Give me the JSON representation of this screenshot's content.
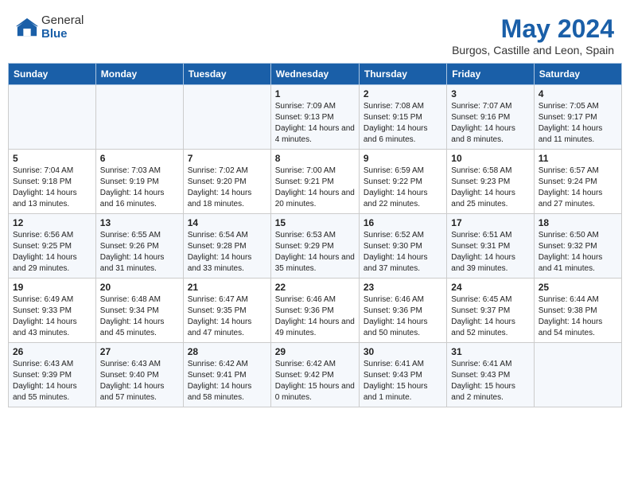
{
  "app": {
    "logo_general": "General",
    "logo_blue": "Blue"
  },
  "header": {
    "title": "May 2024",
    "subtitle": "Burgos, Castille and Leon, Spain"
  },
  "weekdays": [
    "Sunday",
    "Monday",
    "Tuesday",
    "Wednesday",
    "Thursday",
    "Friday",
    "Saturday"
  ],
  "weeks": [
    [
      {
        "day": "",
        "sunrise": "",
        "sunset": "",
        "daylight": ""
      },
      {
        "day": "",
        "sunrise": "",
        "sunset": "",
        "daylight": ""
      },
      {
        "day": "",
        "sunrise": "",
        "sunset": "",
        "daylight": ""
      },
      {
        "day": "1",
        "sunrise": "Sunrise: 7:09 AM",
        "sunset": "Sunset: 9:13 PM",
        "daylight": "Daylight: 14 hours and 4 minutes."
      },
      {
        "day": "2",
        "sunrise": "Sunrise: 7:08 AM",
        "sunset": "Sunset: 9:15 PM",
        "daylight": "Daylight: 14 hours and 6 minutes."
      },
      {
        "day": "3",
        "sunrise": "Sunrise: 7:07 AM",
        "sunset": "Sunset: 9:16 PM",
        "daylight": "Daylight: 14 hours and 8 minutes."
      },
      {
        "day": "4",
        "sunrise": "Sunrise: 7:05 AM",
        "sunset": "Sunset: 9:17 PM",
        "daylight": "Daylight: 14 hours and 11 minutes."
      }
    ],
    [
      {
        "day": "5",
        "sunrise": "Sunrise: 7:04 AM",
        "sunset": "Sunset: 9:18 PM",
        "daylight": "Daylight: 14 hours and 13 minutes."
      },
      {
        "day": "6",
        "sunrise": "Sunrise: 7:03 AM",
        "sunset": "Sunset: 9:19 PM",
        "daylight": "Daylight: 14 hours and 16 minutes."
      },
      {
        "day": "7",
        "sunrise": "Sunrise: 7:02 AM",
        "sunset": "Sunset: 9:20 PM",
        "daylight": "Daylight: 14 hours and 18 minutes."
      },
      {
        "day": "8",
        "sunrise": "Sunrise: 7:00 AM",
        "sunset": "Sunset: 9:21 PM",
        "daylight": "Daylight: 14 hours and 20 minutes."
      },
      {
        "day": "9",
        "sunrise": "Sunrise: 6:59 AM",
        "sunset": "Sunset: 9:22 PM",
        "daylight": "Daylight: 14 hours and 22 minutes."
      },
      {
        "day": "10",
        "sunrise": "Sunrise: 6:58 AM",
        "sunset": "Sunset: 9:23 PM",
        "daylight": "Daylight: 14 hours and 25 minutes."
      },
      {
        "day": "11",
        "sunrise": "Sunrise: 6:57 AM",
        "sunset": "Sunset: 9:24 PM",
        "daylight": "Daylight: 14 hours and 27 minutes."
      }
    ],
    [
      {
        "day": "12",
        "sunrise": "Sunrise: 6:56 AM",
        "sunset": "Sunset: 9:25 PM",
        "daylight": "Daylight: 14 hours and 29 minutes."
      },
      {
        "day": "13",
        "sunrise": "Sunrise: 6:55 AM",
        "sunset": "Sunset: 9:26 PM",
        "daylight": "Daylight: 14 hours and 31 minutes."
      },
      {
        "day": "14",
        "sunrise": "Sunrise: 6:54 AM",
        "sunset": "Sunset: 9:28 PM",
        "daylight": "Daylight: 14 hours and 33 minutes."
      },
      {
        "day": "15",
        "sunrise": "Sunrise: 6:53 AM",
        "sunset": "Sunset: 9:29 PM",
        "daylight": "Daylight: 14 hours and 35 minutes."
      },
      {
        "day": "16",
        "sunrise": "Sunrise: 6:52 AM",
        "sunset": "Sunset: 9:30 PM",
        "daylight": "Daylight: 14 hours and 37 minutes."
      },
      {
        "day": "17",
        "sunrise": "Sunrise: 6:51 AM",
        "sunset": "Sunset: 9:31 PM",
        "daylight": "Daylight: 14 hours and 39 minutes."
      },
      {
        "day": "18",
        "sunrise": "Sunrise: 6:50 AM",
        "sunset": "Sunset: 9:32 PM",
        "daylight": "Daylight: 14 hours and 41 minutes."
      }
    ],
    [
      {
        "day": "19",
        "sunrise": "Sunrise: 6:49 AM",
        "sunset": "Sunset: 9:33 PM",
        "daylight": "Daylight: 14 hours and 43 minutes."
      },
      {
        "day": "20",
        "sunrise": "Sunrise: 6:48 AM",
        "sunset": "Sunset: 9:34 PM",
        "daylight": "Daylight: 14 hours and 45 minutes."
      },
      {
        "day": "21",
        "sunrise": "Sunrise: 6:47 AM",
        "sunset": "Sunset: 9:35 PM",
        "daylight": "Daylight: 14 hours and 47 minutes."
      },
      {
        "day": "22",
        "sunrise": "Sunrise: 6:46 AM",
        "sunset": "Sunset: 9:36 PM",
        "daylight": "Daylight: 14 hours and 49 minutes."
      },
      {
        "day": "23",
        "sunrise": "Sunrise: 6:46 AM",
        "sunset": "Sunset: 9:36 PM",
        "daylight": "Daylight: 14 hours and 50 minutes."
      },
      {
        "day": "24",
        "sunrise": "Sunrise: 6:45 AM",
        "sunset": "Sunset: 9:37 PM",
        "daylight": "Daylight: 14 hours and 52 minutes."
      },
      {
        "day": "25",
        "sunrise": "Sunrise: 6:44 AM",
        "sunset": "Sunset: 9:38 PM",
        "daylight": "Daylight: 14 hours and 54 minutes."
      }
    ],
    [
      {
        "day": "26",
        "sunrise": "Sunrise: 6:43 AM",
        "sunset": "Sunset: 9:39 PM",
        "daylight": "Daylight: 14 hours and 55 minutes."
      },
      {
        "day": "27",
        "sunrise": "Sunrise: 6:43 AM",
        "sunset": "Sunset: 9:40 PM",
        "daylight": "Daylight: 14 hours and 57 minutes."
      },
      {
        "day": "28",
        "sunrise": "Sunrise: 6:42 AM",
        "sunset": "Sunset: 9:41 PM",
        "daylight": "Daylight: 14 hours and 58 minutes."
      },
      {
        "day": "29",
        "sunrise": "Sunrise: 6:42 AM",
        "sunset": "Sunset: 9:42 PM",
        "daylight": "Daylight: 15 hours and 0 minutes."
      },
      {
        "day": "30",
        "sunrise": "Sunrise: 6:41 AM",
        "sunset": "Sunset: 9:43 PM",
        "daylight": "Daylight: 15 hours and 1 minute."
      },
      {
        "day": "31",
        "sunrise": "Sunrise: 6:41 AM",
        "sunset": "Sunset: 9:43 PM",
        "daylight": "Daylight: 15 hours and 2 minutes."
      },
      {
        "day": "",
        "sunrise": "",
        "sunset": "",
        "daylight": ""
      }
    ]
  ]
}
